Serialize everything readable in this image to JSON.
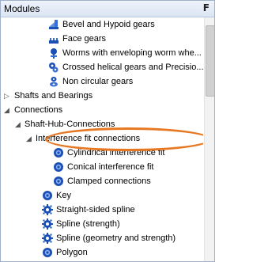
{
  "panel": {
    "title": "Modules",
    "pin_icon": "pin-icon"
  },
  "items": [
    {
      "label": "Bevel and Hypoid gears",
      "icon": "bevel-gear-icon"
    },
    {
      "label": "Face gears",
      "icon": "face-gear-icon"
    },
    {
      "label": "Worms with enveloping worm whe...",
      "icon": "worm-gear-icon"
    },
    {
      "label": "Crossed helical gears and Precisio...",
      "icon": "crossed-helical-gear-icon"
    },
    {
      "label": "Non circular gears",
      "icon": "non-circular-gear-icon"
    },
    {
      "label": "Shafts and Bearings",
      "expander": "▷"
    },
    {
      "label": "Connections",
      "expander": "◢"
    },
    {
      "label": "Shaft-Hub-Connections",
      "expander": "◢"
    },
    {
      "label": "Interference fit connections",
      "expander": "◢"
    },
    {
      "label": "Cylindrical interference fit",
      "icon": "blue-ring-icon"
    },
    {
      "label": "Conical interference fit",
      "icon": "blue-ring-icon"
    },
    {
      "label": "Clamped connections",
      "icon": "blue-ring-icon"
    },
    {
      "label": "Key",
      "icon": "blue-ring-icon"
    },
    {
      "label": "Straight-sided spline",
      "icon": "spline-gear-icon"
    },
    {
      "label": "Spline (strength)",
      "icon": "spline-gear-icon"
    },
    {
      "label": "Spline (geometry and strength)",
      "icon": "spline-gear-icon"
    },
    {
      "label": "Polygon",
      "icon": "blue-ring-icon"
    }
  ],
  "colors": {
    "highlight": "#e87722",
    "accent": "#1a4fb5"
  }
}
